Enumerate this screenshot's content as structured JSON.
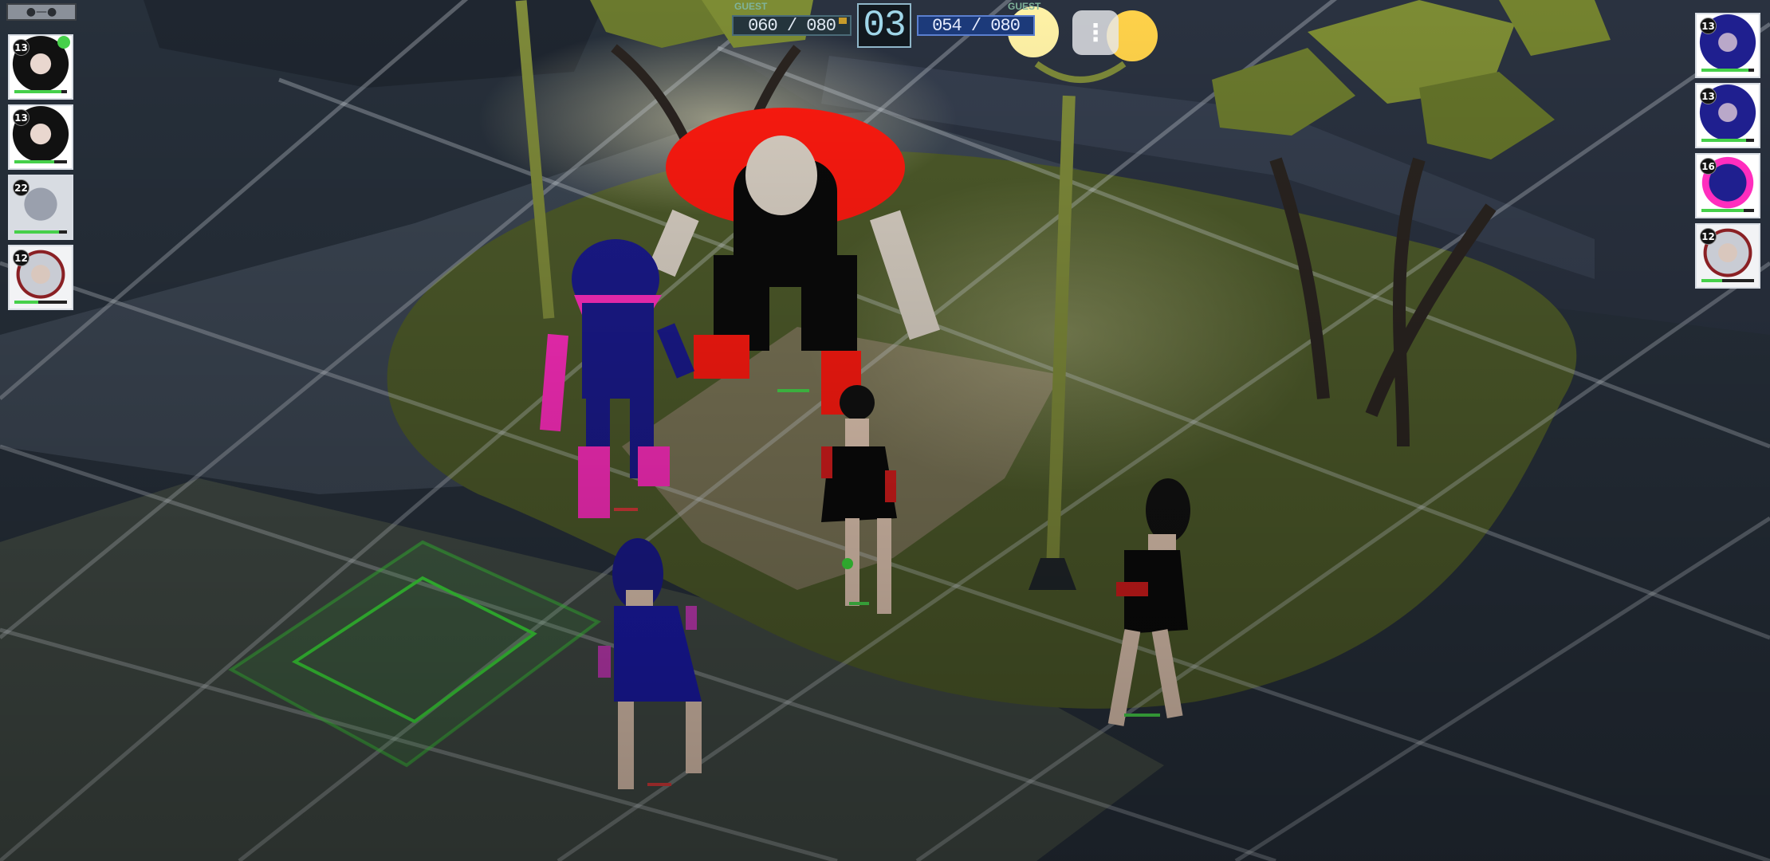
{
  "hud": {
    "left_team": {
      "label": "GUEST",
      "score": "060 / 080"
    },
    "right_team": {
      "label": "GUEST",
      "score": "054 / 080"
    },
    "turn_counter": "03",
    "menu_icon": "mask-icon",
    "options_icon": "vertical-dots-icon"
  },
  "left_roster": [
    {
      "level": "13",
      "name": "dark-haired-heroine",
      "hp": 0.9,
      "status_icon": "shield-badge-icon"
    },
    {
      "level": "13",
      "name": "dark-haired-heroine",
      "hp": 0.75
    },
    {
      "level": "22",
      "name": "grey-brute",
      "hp": 0.85
    },
    {
      "level": "12",
      "name": "horned-sorceress",
      "hp": 0.45
    }
  ],
  "right_roster": [
    {
      "level": "13",
      "name": "blue-haired-heroine",
      "hp": 0.9
    },
    {
      "level": "13",
      "name": "blue-haired-heroine",
      "hp": 0.85
    },
    {
      "level": "16",
      "name": "masked-hero",
      "hp": 0.8
    },
    {
      "level": "12",
      "name": "horned-sorceress",
      "hp": 0.4
    }
  ],
  "colors": {
    "left_team_accent": "#2e6fd8",
    "right_team_accent": "#1d8f3c",
    "hp_green": "#46d04a",
    "hp_red": "#d83a3a",
    "move_grid": "#3cd83a"
  }
}
